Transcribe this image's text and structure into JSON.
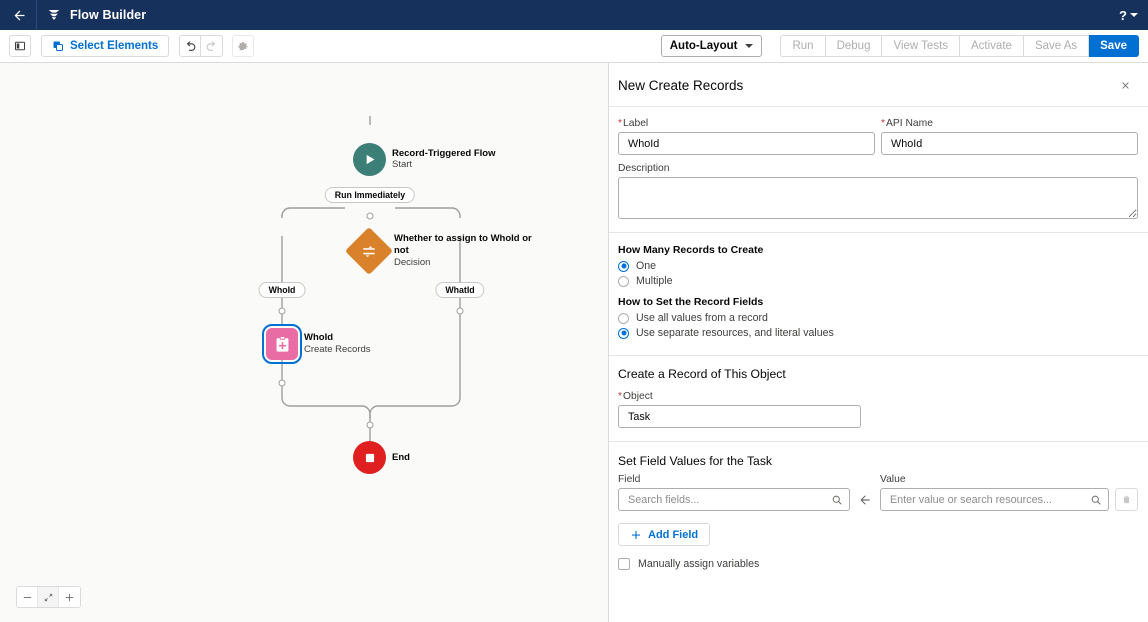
{
  "header": {
    "title": "Flow Builder",
    "back_icon": "arrow-left-icon",
    "logo_icon": "flow-builder-logo-icon",
    "help_label": "?",
    "help_icon": "question-mark-icon"
  },
  "toolbar": {
    "panel_toggle_icon": "toggle-left-panel-icon",
    "select_elements_label": "Select Elements",
    "select_elements_icon": "copy-elements-icon",
    "undo_icon": "undo-icon",
    "redo_icon": "redo-icon",
    "settings_icon": "gear-icon",
    "layout_label": "Auto-Layout",
    "layout_caret_icon": "chevron-down-icon",
    "buttons": [
      {
        "label": "Run",
        "state": "disabled"
      },
      {
        "label": "Debug",
        "state": "disabled"
      },
      {
        "label": "View Tests",
        "state": "disabled"
      },
      {
        "label": "Activate",
        "state": "disabled"
      },
      {
        "label": "Save As",
        "state": "disabled"
      },
      {
        "label": "Save",
        "state": "primary"
      }
    ]
  },
  "canvas": {
    "nodes": {
      "start": {
        "title": "Record-Triggered Flow",
        "subtitle": "Start",
        "icon": "play-icon",
        "color": "#3c7f77"
      },
      "run_immediately_pill": "Run Immediately",
      "decision": {
        "title": "Whether to assign to WhoId or not",
        "subtitle": "Decision",
        "icon": "decision-sliders-icon",
        "color": "#d9822b"
      },
      "branch_left_pill": "WhoId",
      "branch_right_pill": "WhatId",
      "create_records": {
        "title": "WhoId",
        "subtitle": "Create Records",
        "icon": "create-records-clipboard-icon",
        "color": "#ea6ca4",
        "selected": true
      },
      "end": {
        "title": "End",
        "icon": "stop-square-icon",
        "color": "#e02020"
      }
    },
    "zoom_controls": {
      "zoom_out_icon": "minus-icon",
      "fit_icon": "fit-to-view-icon",
      "zoom_in_icon": "plus-icon"
    }
  },
  "panel": {
    "title": "New Create Records",
    "close_icon": "close-icon",
    "label_field": {
      "label": "Label",
      "required": true,
      "value": "WhoId"
    },
    "api_name_field": {
      "label": "API Name",
      "required": true,
      "value": "WhoId"
    },
    "description_field": {
      "label": "Description",
      "value": ""
    },
    "how_many": {
      "title": "How Many Records to Create",
      "options": [
        {
          "label": "One",
          "selected": true
        },
        {
          "label": "Multiple",
          "selected": false
        }
      ]
    },
    "how_to_set": {
      "title": "How to Set the Record Fields",
      "options": [
        {
          "label": "Use all values from a record",
          "selected": false
        },
        {
          "label": "Use separate resources, and literal values",
          "selected": true
        }
      ]
    },
    "object_section": {
      "heading": "Create a Record of This Object",
      "object_label": "Object",
      "object_required": true,
      "object_value": "Task"
    },
    "field_values_section": {
      "heading": "Set Field Values for the Task",
      "field_label": "Field",
      "field_placeholder": "Search fields...",
      "field_value": "",
      "field_search_icon": "search-icon",
      "arrow_icon": "arrow-left-icon",
      "value_label": "Value",
      "value_placeholder": "Enter value or search resources...",
      "value_value": "",
      "value_search_icon": "search-icon",
      "delete_icon": "trash-icon",
      "add_field_label": "Add Field",
      "add_field_icon": "plus-icon",
      "manual_assign_label": "Manually assign variables",
      "manual_assign_checked": false
    }
  },
  "colors": {
    "header_bg": "#16325c",
    "accent_blue": "#0070d2",
    "start_teal": "#3c7f77",
    "decision_orange": "#d9822b",
    "create_pink": "#ea6ca4",
    "end_red": "#e02020",
    "required_red": "#c23934"
  }
}
